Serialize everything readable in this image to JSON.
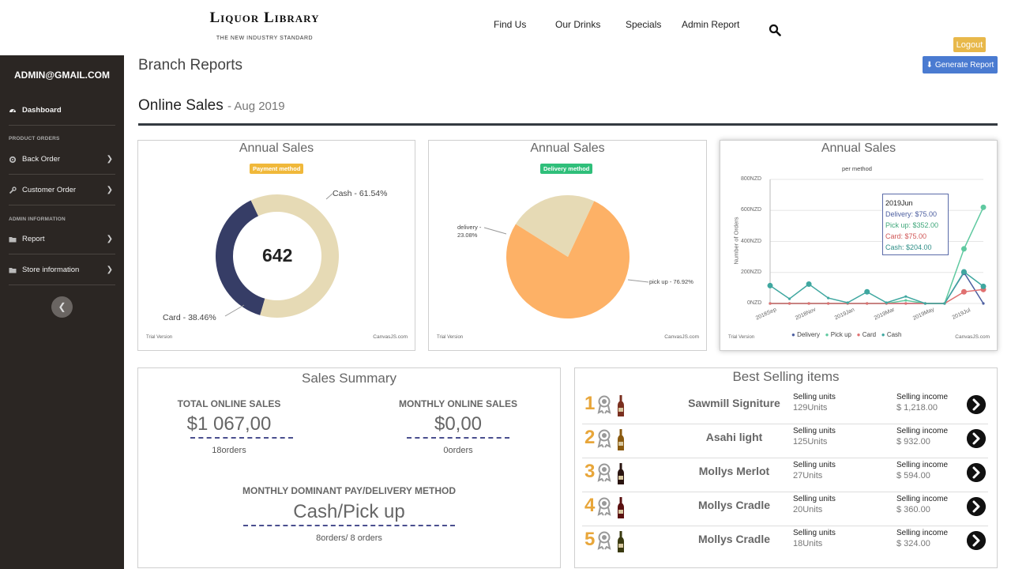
{
  "header": {
    "logo_title": "Liquor Library",
    "logo_subtitle": "THE NEW INDUSTRY STANDARD",
    "nav": [
      "Find Us",
      "Our Drinks",
      "Specials",
      "Admin Report"
    ],
    "logout_label": "Logout"
  },
  "sidebar": {
    "user": "ADMIN@GMAIL.COM",
    "dashboard": "Dashboard",
    "product_orders_heading": "PRODUCT ORDERS",
    "back_order": "Back Order",
    "customer_order": "Customer Order",
    "admin_info_heading": "ADMIN INFORMATION",
    "report": "Report",
    "store_info": "Store information"
  },
  "main": {
    "page_title": "Branch Reports",
    "generate_label": "Generate Report",
    "section_title": "Online Sales",
    "section_sub": "- Aug 2019"
  },
  "chart_common": {
    "trial": "Trial Version",
    "credit": "CanvasJS.com"
  },
  "chart_data": [
    {
      "type": "pie",
      "title": "Annual Sales",
      "subtitle": "Payment method",
      "center_label": "642",
      "slices": [
        {
          "label": "Cash - 61.54%",
          "value": 61.54,
          "color": "#e6dab5"
        },
        {
          "label": "Card - 38.46%",
          "value": 38.46,
          "color": "#363d66"
        }
      ]
    },
    {
      "type": "pie",
      "title": "Annual Sales",
      "subtitle": "Delivery method",
      "slices": [
        {
          "label": "pick up - 76.92%",
          "value": 76.92,
          "color": "#fdb166"
        },
        {
          "label": "delivery - 23.08%",
          "value": 23.08,
          "color": "#e6dab5"
        }
      ]
    },
    {
      "type": "line",
      "title": "Annual Sales",
      "subtitle": "per method",
      "ylabel": "Number of Orders",
      "ylim": [
        0,
        800
      ],
      "y_ticks": [
        "0NZD",
        "200NZD",
        "400NZD",
        "600NZD",
        "800NZD"
      ],
      "x_ticks": [
        "2018Sep",
        "2018Nov",
        "2019Jan",
        "2019Mar",
        "2019May",
        "2019Jul"
      ],
      "x": [
        0,
        1,
        2,
        3,
        4,
        5,
        6,
        7,
        8,
        9,
        10,
        11
      ],
      "series": [
        {
          "name": "Delivery",
          "color": "#4d5fa0",
          "values": [
            0,
            0,
            0,
            0,
            0,
            0,
            0,
            0,
            0,
            0,
            200,
            0
          ]
        },
        {
          "name": "Pick up",
          "color": "#5fc9a0",
          "values": [
            0,
            0,
            0,
            0,
            0,
            0,
            0,
            20,
            0,
            0,
            352,
            620
          ]
        },
        {
          "name": "Card",
          "color": "#e07070",
          "values": [
            0,
            0,
            0,
            0,
            0,
            0,
            0,
            0,
            0,
            0,
            75,
            90
          ]
        },
        {
          "name": "Cash",
          "color": "#3fa7a0",
          "values": [
            115,
            30,
            125,
            35,
            5,
            75,
            5,
            45,
            0,
            0,
            204,
            110
          ]
        }
      ],
      "tooltip": {
        "title": "2019Jun",
        "rows": [
          "Delivery:  $75.00",
          "Pick up:  $352.00",
          "Card:  $75.00",
          "Cash:  $204.00"
        ]
      }
    }
  ],
  "summary": {
    "title": "Sales Summary",
    "total_label": "TOTAL ONLINE SALES",
    "total_value": "$1 067,00",
    "total_sub": "18orders",
    "monthly_label": "MONTHLY ONLINE SALES",
    "monthly_value": "$0,00",
    "monthly_sub": "0orders",
    "dominant_label": "MONTHLY DOMINANT PAY/DELIVERY METHOD",
    "dominant_value": "Cash/Pick up",
    "dominant_sub": "8orders/ 8 orders"
  },
  "best": {
    "title": "Best Selling items",
    "units_label": "Selling units",
    "income_label": "Selling income",
    "items": [
      {
        "rank": "1",
        "name": "Sawmill Signiture",
        "units": "129Units",
        "income": "$ 1,218.00"
      },
      {
        "rank": "2",
        "name": "Asahi light",
        "units": "125Units",
        "income": "$ 932.00"
      },
      {
        "rank": "3",
        "name": "Mollys Merlot",
        "units": "27Units",
        "income": "$ 594.00"
      },
      {
        "rank": "4",
        "name": "Mollys Cradle",
        "units": "20Units",
        "income": "$ 360.00"
      },
      {
        "rank": "5",
        "name": "Mollys Cradle",
        "units": "18Units",
        "income": "$ 324.00"
      }
    ]
  },
  "colors": {
    "payment_badge": "#f0b83a",
    "delivery_badge": "#2fbf7a",
    "accent": "#4a7bd1",
    "sidebar": "#2b2623"
  },
  "icons": [
    "search-icon",
    "dashboard-icon",
    "gear-icon",
    "wrench-icon",
    "folder-icon",
    "chevron-right-icon",
    "chevron-left-icon",
    "medal-icon",
    "bottle-icon",
    "arrow-right-icon",
    "download-icon"
  ]
}
